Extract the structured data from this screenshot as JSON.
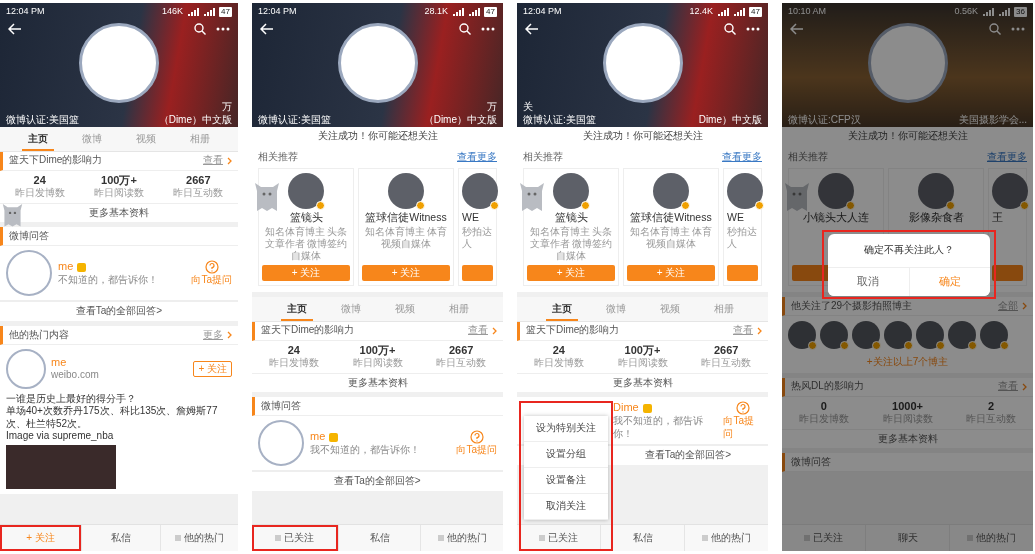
{
  "phones": [
    {
      "status_bar": {
        "time": "12:04 PM",
        "speed": "146K",
        "battery": "47"
      },
      "cover": {
        "kind": "court",
        "line1": {
          "right": "万"
        },
        "line2": {
          "left": "微博认证:美国篮",
          "right": "（Dime）中文版"
        }
      },
      "sections": [
        {
          "kind": "tabs",
          "tabs": [
            {
              "label": "主页",
              "selected": true
            },
            {
              "label": "微博",
              "selected": false
            },
            {
              "label": "视频",
              "selected": false
            },
            {
              "label": "相册",
              "selected": false
            }
          ]
        },
        {
          "kind": "influence",
          "title": "篮天下Dime的影响力",
          "more": "查看",
          "stats": [
            {
              "value": "24",
              "label": "昨日发博数"
            },
            {
              "value": "100万+",
              "label": "昨日阅读数"
            },
            {
              "value": "2667",
              "label": "昨日互动数"
            }
          ],
          "link": "更多基本资料"
        },
        {
          "kind": "qa",
          "title": "微博问答",
          "avatar": true,
          "name": "me",
          "desc": "不知道的，都告诉你！",
          "ask": "向Ta提问",
          "link": "查看Ta的全部回答>"
        },
        {
          "kind": "hot",
          "title": "他的热门内容",
          "more": "更多",
          "name": "me",
          "source": "weibo.com",
          "follow": "+ 关注",
          "lines": [
            "一谁是历史上最好的得分手？",
            "单场40+次数乔丹175次、科比135次、詹姆斯77次、杜兰特52次。",
            "Image via supreme_nba"
          ]
        }
      ],
      "bottom_bar": [
        {
          "label": "+ 关注",
          "kind": "follow",
          "highlighted": true
        },
        {
          "label": "私信",
          "kind": "message",
          "highlighted": false
        },
        {
          "label": "他的热门",
          "kind": "hot",
          "highlighted": false
        }
      ]
    },
    {
      "status_bar": {
        "time": "12:04 PM",
        "speed": "28.1K",
        "battery": "47"
      },
      "cover": {
        "kind": "court",
        "line1": {
          "right": "万"
        },
        "line2": {
          "left": "微博认证:美国篮",
          "right": "（Dime）中文版"
        }
      },
      "sections": [
        {
          "kind": "notice",
          "text": "关注成功！你可能还想关注"
        },
        {
          "kind": "recommend",
          "title": "相关推荐",
          "more": "查看更多",
          "cards": [
            {
              "name": "篮镜头",
              "desc": "知名体育博主 头条文章作者 微博签约自媒体",
              "button": "+ 关注"
            },
            {
              "name": "篮球信徒Witness",
              "desc": "知名体育博主 体育视频自媒体",
              "button": "+ 关注"
            },
            {
              "name": "WE",
              "desc": "秒拍达人"
            }
          ]
        },
        {
          "kind": "tabs",
          "tabs": [
            {
              "label": "主页",
              "selected": true
            },
            {
              "label": "微博",
              "selected": false
            },
            {
              "label": "视频",
              "selected": false
            },
            {
              "label": "相册",
              "selected": false
            }
          ]
        },
        {
          "kind": "influence",
          "title": "篮天下Dime的影响力",
          "more": "查看",
          "stats": [
            {
              "value": "24",
              "label": "昨日发博数"
            },
            {
              "value": "100万+",
              "label": "昨日阅读数"
            },
            {
              "value": "2667",
              "label": "昨日互动数"
            }
          ],
          "link": "更多基本资料"
        },
        {
          "kind": "qa",
          "title": "微博问答",
          "avatar": true,
          "name": "me",
          "desc": "我不知道的，都告诉你！",
          "ask": "向Ta提问",
          "link": "查看Ta的全部回答>"
        }
      ],
      "bottom_bar": [
        {
          "label": "已关注",
          "kind": "followed",
          "highlighted": true
        },
        {
          "label": "私信",
          "kind": "message",
          "highlighted": false
        },
        {
          "label": "他的热门",
          "kind": "hot",
          "highlighted": false
        }
      ]
    },
    {
      "status_bar": {
        "time": "12:04 PM",
        "speed": "12.4K",
        "battery": "47"
      },
      "cover": {
        "kind": "court",
        "line1": {
          "left": "关"
        },
        "line2": {
          "left": "微博认证:美国篮",
          "right": "Dime）中文版"
        }
      },
      "sections": [
        {
          "kind": "notice",
          "text": "关注成功！你可能还想关注"
        },
        {
          "kind": "recommend",
          "title": "相关推荐",
          "more": "查看更多",
          "cards": [
            {
              "name": "篮镜头",
              "desc": "知名体育博主 头条文章作者 微博签约自媒体",
              "button": "+ 关注"
            },
            {
              "name": "篮球信徒Witness",
              "desc": "知名体育博主 体育视频自媒体",
              "button": "+ 关注"
            },
            {
              "name": "WE",
              "desc": "秒拍达人"
            }
          ]
        },
        {
          "kind": "tabs",
          "tabs": [
            {
              "label": "主页",
              "selected": true
            },
            {
              "label": "微博",
              "selected": false
            },
            {
              "label": "视频",
              "selected": false
            },
            {
              "label": "相册",
              "selected": false
            }
          ]
        },
        {
          "kind": "influence",
          "title": "篮天下Dime的影响力",
          "more": "查看",
          "stats": [
            {
              "value": "24",
              "label": "昨日发博数"
            },
            {
              "value": "100万+",
              "label": "昨日阅读数"
            },
            {
              "value": "2667",
              "label": "昨日互动数"
            }
          ],
          "link": "更多基本资料"
        },
        {
          "kind": "qa",
          "avatar": false,
          "name": "Dime",
          "desc": "我不知道的，都告诉你！",
          "ask": "向Ta提问",
          "link": "查看Ta的全部回答>"
        }
      ],
      "menu": {
        "highlighted": true,
        "items": [
          "设为特别关注",
          "设置分组",
          "设置备注",
          "取消关注"
        ]
      },
      "bottom_bar": [
        {
          "label": "已关注",
          "kind": "followed"
        },
        {
          "label": "私信",
          "kind": "message"
        },
        {
          "label": "他的热门",
          "kind": "hot"
        }
      ]
    },
    {
      "status_bar": {
        "time": "10:10 AM",
        "speed": "0.56K",
        "battery": "36"
      },
      "cover": {
        "kind": "sunset",
        "line2": {
          "left": "微博认证:CFP汉",
          "right": "美国摄影学会..."
        }
      },
      "dimmed": true,
      "sections": [
        {
          "kind": "notice",
          "text": "关注成功！你可能还想关注"
        },
        {
          "kind": "recommend",
          "title": "相关推荐",
          "more": "查看更多",
          "cards": [
            {
              "name": "小镜头大人连"
            },
            {
              "name": "影像杂食者"
            },
            {
              "name": "王"
            }
          ]
        },
        {
          "kind": "following",
          "title": "他关注了29个摄影拍照博主",
          "more": "全部",
          "avatars": [
            {
              "verified": true
            },
            {
              "verified": true
            },
            {
              "verified": true
            },
            {
              "verified": true
            },
            {
              "verified": true
            },
            {
              "verified": true
            },
            {
              "verified": true
            }
          ],
          "link": "+关注以上7个博主"
        },
        {
          "kind": "influence",
          "title": "热风DL的影响力",
          "more": "查看",
          "stats": [
            {
              "value": "0",
              "label": "昨日发博数"
            },
            {
              "value": "1000+",
              "label": "昨日阅读数"
            },
            {
              "value": "2",
              "label": "昨日互动数"
            }
          ],
          "link": "更多基本资料"
        },
        {
          "kind": "qa",
          "title": "微博问答"
        }
      ],
      "dialog": {
        "highlighted": true,
        "message": "确定不再关注此人？",
        "buttons": [
          {
            "label": "取消",
            "kind": "cancel"
          },
          {
            "label": "确定",
            "kind": "confirm"
          }
        ]
      },
      "bottom_bar": [
        {
          "label": "已关注",
          "kind": "followed"
        },
        {
          "label": "聊天",
          "kind": "message"
        },
        {
          "label": "他的热门",
          "kind": "hot"
        }
      ]
    }
  ]
}
